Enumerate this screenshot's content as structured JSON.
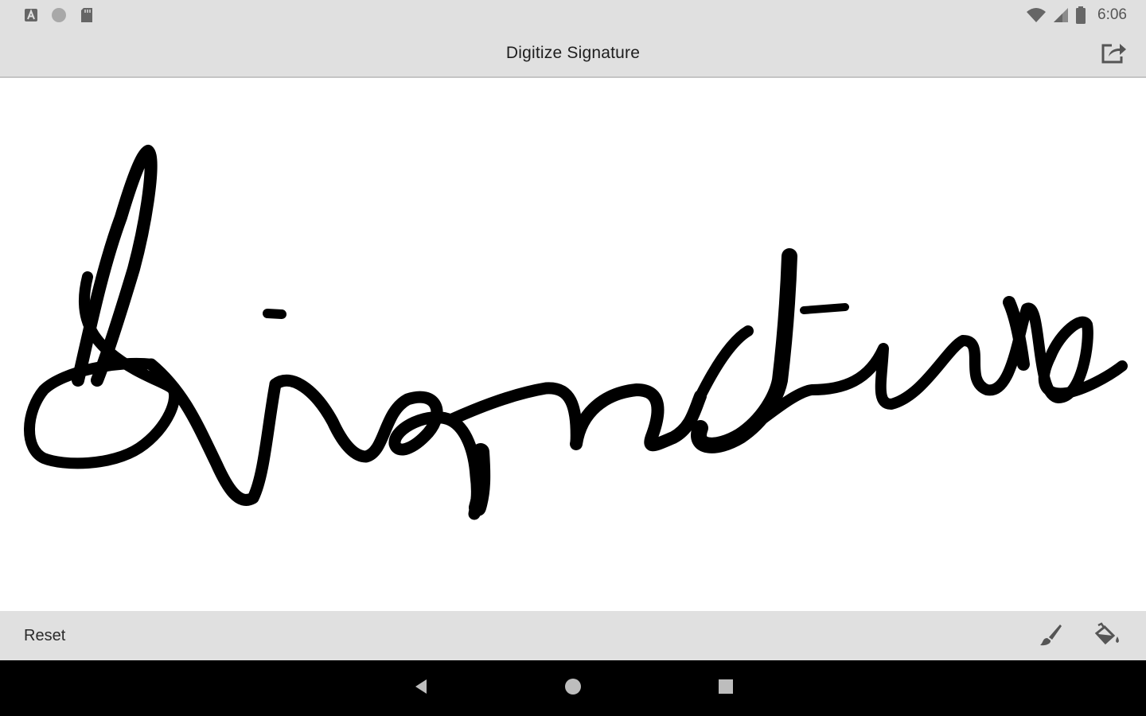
{
  "status_bar": {
    "time": "6:06",
    "icons": [
      "notification-a-icon",
      "circle-notification-icon",
      "sd-card-icon",
      "wifi-icon",
      "cell-signal-icon",
      "battery-icon"
    ]
  },
  "app_bar": {
    "title": "Digitize Signature",
    "share_icon": "share-icon"
  },
  "canvas": {
    "content": "Signature",
    "stroke_color": "#000000",
    "background": "#ffffff"
  },
  "bottom_bar": {
    "reset_label": "Reset",
    "tools": [
      "brush-icon",
      "paint-bucket-icon"
    ]
  },
  "nav_bar": {
    "buttons": [
      "back-icon",
      "home-icon",
      "recents-icon"
    ]
  },
  "colors": {
    "bar_background": "#e0e0e0",
    "nav_background": "#000000"
  }
}
